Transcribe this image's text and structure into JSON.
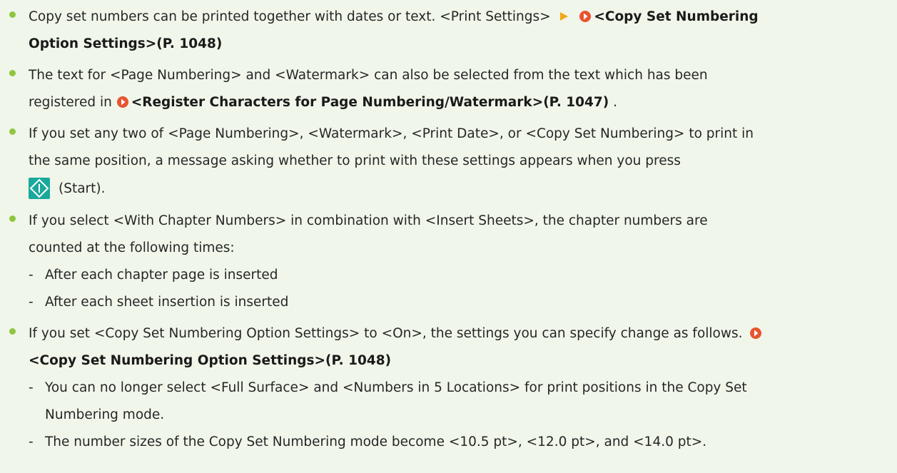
{
  "colors": {
    "background": "#f1f6ea",
    "bullet": "#8dc63f",
    "link_icon": "#e8542f",
    "arrow_icon": "#f2a71b",
    "start_icon": "#1aa89c"
  },
  "icons": {
    "bullet": "green-dot",
    "link": "orange-circle-arrow-icon",
    "arrow": "orange-triangle-arrow-icon",
    "start": "start-key-icon"
  },
  "items": [
    {
      "line1_text": "Copy set numbers can be printed together with dates or text. <Print Settings>",
      "line1_ref": "<Copy Set Numbering",
      "line2_ref": "Option Settings>(P. 1048)"
    },
    {
      "line1_text": "The text for <Page Numbering> and <Watermark> can also be selected from the text which has been",
      "line2_text": "registered in",
      "line2_ref": "<Register Characters for Page Numbering/Watermark>(P. 1047)",
      "line2_tail": " ."
    },
    {
      "line1_text": "If you set any two of <Page Numbering>, <Watermark>, <Print Date>, or <Copy Set Numbering> to print in",
      "line2_text": "the same position, a message asking whether to print with these settings appears when you press",
      "line3_text": "(Start)."
    },
    {
      "line1_text": "If you select <With Chapter Numbers> in combination with <Insert Sheets>, the chapter numbers are",
      "line2_text": "counted at the following times:",
      "subs": [
        "After each chapter page is inserted",
        "After each sheet insertion is inserted"
      ]
    },
    {
      "line1_text": "If you set <Copy Set Numbering Option Settings> to <On>, the settings you can specify change as follows.",
      "line2_ref": "<Copy Set Numbering Option Settings>(P. 1048)",
      "subs": [
        {
          "line1": "You can no longer select <Full Surface> and <Numbers in 5 Locations> for print positions in the Copy Set",
          "line2": "Numbering mode."
        },
        {
          "line1": "The number sizes of the Copy Set Numbering mode become <10.5 pt>, <12.0 pt>, and <14.0 pt>."
        }
      ]
    }
  ]
}
